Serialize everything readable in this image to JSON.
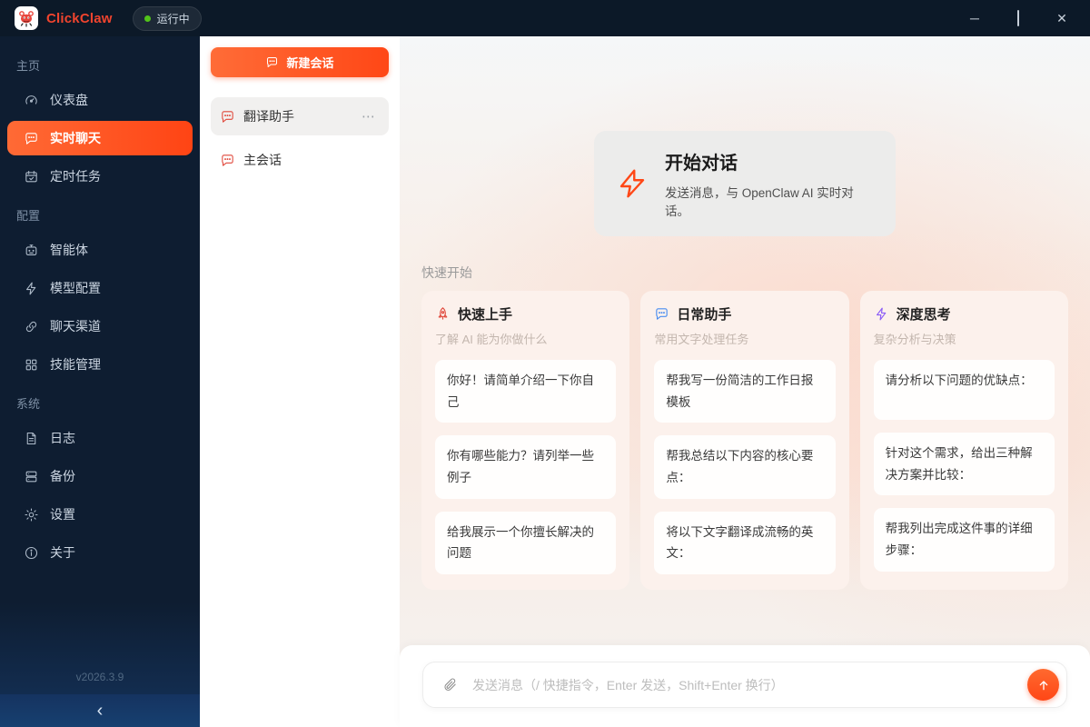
{
  "titlebar": {
    "app_name": "ClickClaw",
    "status": "运行中",
    "minimize_glyph": "─",
    "close_glyph": "✕"
  },
  "sidebar": {
    "sections": [
      {
        "label": "主页",
        "items": [
          {
            "icon": "gauge-icon",
            "label": "仪表盘"
          },
          {
            "icon": "chat-bubble-icon",
            "label": "实时聊天",
            "active": true
          },
          {
            "icon": "calendar-icon",
            "label": "定时任务"
          }
        ]
      },
      {
        "label": "配置",
        "items": [
          {
            "icon": "robot-icon",
            "label": "智能体"
          },
          {
            "icon": "bolt-icon",
            "label": "模型配置"
          },
          {
            "icon": "link-icon",
            "label": "聊天渠道"
          },
          {
            "icon": "grid-icon",
            "label": "技能管理"
          }
        ]
      },
      {
        "label": "系统",
        "items": [
          {
            "icon": "document-icon",
            "label": "日志"
          },
          {
            "icon": "server-icon",
            "label": "备份"
          },
          {
            "icon": "gear-icon",
            "label": "设置"
          },
          {
            "icon": "info-icon",
            "label": "关于"
          }
        ]
      }
    ],
    "version": "v2026.3.9",
    "collapse_glyph": "‹"
  },
  "sessions": {
    "new_button_label": "新建会话",
    "items": [
      {
        "icon": "chat-bubble-icon",
        "label": "翻译助手",
        "active": true,
        "menu_glyph": "⋯"
      },
      {
        "icon": "chat-bubble-icon",
        "label": "主会话"
      }
    ]
  },
  "main": {
    "hero": {
      "icon": "lightning-icon",
      "title": "开始对话",
      "subtitle": "发送消息，与 OpenClaw AI 实时对话。"
    },
    "quickstart_label": "快速开始",
    "cards": [
      {
        "icon": "rocket-icon",
        "accent": "#e0473a",
        "title": "快速上手",
        "subtitle": "了解 AI 能为你做什么",
        "prompts": [
          "你好！请简单介绍一下你自己",
          "你有哪些能力？请列举一些例子",
          "给我展示一个你擅长解决的问题"
        ]
      },
      {
        "icon": "chat-bubble-icon",
        "accent": "#4a8df0",
        "title": "日常助手",
        "subtitle": "常用文字处理任务",
        "prompts": [
          "帮我写一份简洁的工作日报模板",
          "帮我总结以下内容的核心要点：",
          "将以下文字翻译成流畅的英文："
        ]
      },
      {
        "icon": "bolt-icon",
        "accent": "#8b5cf6",
        "title": "深度思考",
        "subtitle": "复杂分析与决策",
        "prompts": [
          "请分析以下问题的优缺点：",
          "针对这个需求，给出三种解决方案并比较：",
          "帮我列出完成这件事的详细步骤："
        ]
      }
    ],
    "composer": {
      "placeholder": "发送消息（/ 快捷指令，Enter 发送，Shift+Enter 换行）"
    }
  },
  "colors": {
    "accent": "#ff4716",
    "sidebar_bg": "#0e1d31",
    "status_green": "#52c41a"
  }
}
